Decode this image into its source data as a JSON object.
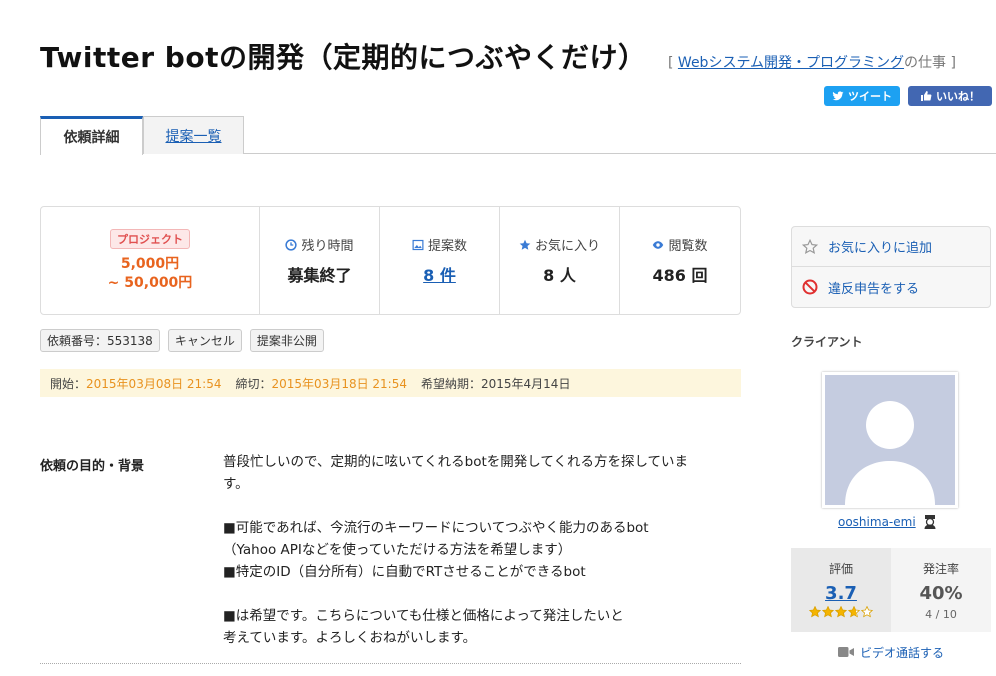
{
  "header": {
    "title": "Twitter botの開発（定期的につぶやくだけ）",
    "category_prefix": "[ ",
    "category_link": "Webシステム開発・プログラミング",
    "category_suffix": "の仕事 ]"
  },
  "share": {
    "tweet": "ツイート",
    "like": "いいね！"
  },
  "tabs": [
    {
      "label": "依頼詳細",
      "active": true
    },
    {
      "label": "提案一覧",
      "active": false
    }
  ],
  "budget": {
    "badge": "プロジェクト",
    "min": "5,000円",
    "max": "~ 50,000円"
  },
  "stats": [
    {
      "label": "残り時間",
      "value": "募集終了",
      "icon": "clock-icon"
    },
    {
      "label": "提案数",
      "value": "8 件",
      "icon": "image-icon"
    },
    {
      "label": "お気に入り",
      "value": "8 人",
      "icon": "star-icon"
    },
    {
      "label": "閲覧数",
      "value": "486 回",
      "icon": "eye-icon"
    }
  ],
  "tags": [
    "依頼番号：553138",
    "キャンセル",
    "提案非公開"
  ],
  "dates": {
    "start_label": "開始：",
    "start": "2015年03月08日 21:54",
    "end_label": "締切：",
    "end": "2015年03月18日 21:54",
    "delivery": "希望納期：2015年4月14日"
  },
  "purpose": {
    "label": "依頼の目的・背景",
    "lines": [
      "普段忙しいので、定期的に呟いてくれるbotを開発してくれる方を探していま",
      "す。",
      "",
      "■可能であれば、今流行のキーワードについてつぶやく能力のあるbot",
      "（Yahoo APIなどを使っていただける方法を希望します）",
      "■特定のID（自分所有）に自動でRTさせることができるbot",
      "",
      "■は希望です。こちらについても仕様と価格によって発注したいと",
      "考えています。よろしくおねがいします。"
    ]
  },
  "sidebar": {
    "favorite": "お気に入りに追加",
    "report": "違反申告をする",
    "client_label": "クライアント",
    "username": "ooshima-emi",
    "rating_label": "評価",
    "rating_value": "3.7",
    "rating_stars": 3.7,
    "order_rate_label": "発注率",
    "order_rate": "40%",
    "order_ratio": "4 / 10",
    "video": "ビデオ通話する"
  },
  "colors": {
    "link": "#1a5fb4",
    "budget": "#e8641f",
    "date_highlight": "#e8921f",
    "twitter": "#1da1f2",
    "facebook": "#4267b2"
  }
}
